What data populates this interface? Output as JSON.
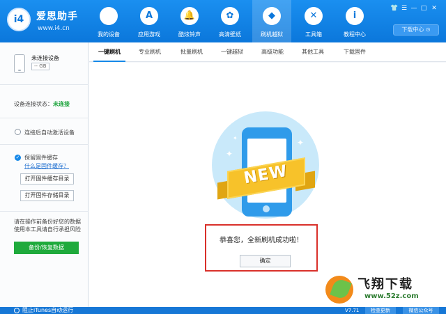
{
  "app": {
    "brand": "爱思助手",
    "url": "www.i4.cn",
    "logo_text": "i4"
  },
  "nav": [
    {
      "label": "我的设备",
      "icon": "apple-icon",
      "glyph": ""
    },
    {
      "label": "应用游戏",
      "icon": "app-store-icon",
      "glyph": "A"
    },
    {
      "label": "酷炫铃声",
      "icon": "bell-icon",
      "glyph": "🔔"
    },
    {
      "label": "高清壁纸",
      "icon": "flower-icon",
      "glyph": "✿"
    },
    {
      "label": "刷机越狱",
      "icon": "dropbox-icon",
      "glyph": "◆"
    },
    {
      "label": "工具箱",
      "icon": "wrench-icon",
      "glyph": "✕"
    },
    {
      "label": "教程中心",
      "icon": "info-icon",
      "glyph": "i"
    }
  ],
  "window": {
    "download_center": "下载中心 ⊙",
    "controls": [
      "👕",
      "☰",
      "—",
      "□",
      "✕"
    ]
  },
  "sidebar": {
    "device_name": "未连接设备",
    "device_badge": "-- GB",
    "connection_label": "设备连接状态：",
    "connection_value": "未连接",
    "auto_activate": "连接后自动激活设备",
    "keep_firmware": "保留固件缓存",
    "keep_firmware_link": "什么是固件缓存？",
    "open_cache_dir": "打开固件缓存目录",
    "open_storage_dir": "打开固件存储目录",
    "warning": "请在操作前备份好您的数据使用本工具请自行承担风险",
    "backup_button": "备份/恢复数据"
  },
  "tabs": [
    "一键刷机",
    "专业刷机",
    "批量刷机",
    "一键越狱",
    "高级功能",
    "其他工具",
    "下载固件"
  ],
  "main": {
    "badge_text": "NEW",
    "success_message": "恭喜您，全新刷机成功啦！",
    "ok_button": "确定"
  },
  "watermark": {
    "title": "飞翔下载",
    "url": "www.52z.com"
  },
  "status": {
    "itunes_label": "阻止iTunes自动运行",
    "version": "V7.71",
    "check_update": "检查更新",
    "wechat": "微信公众号"
  },
  "colors": {
    "accent": "#0b77db",
    "success": "#1faa3c",
    "highlight_border": "#d9302a",
    "ribbon": "#f7c22a"
  }
}
